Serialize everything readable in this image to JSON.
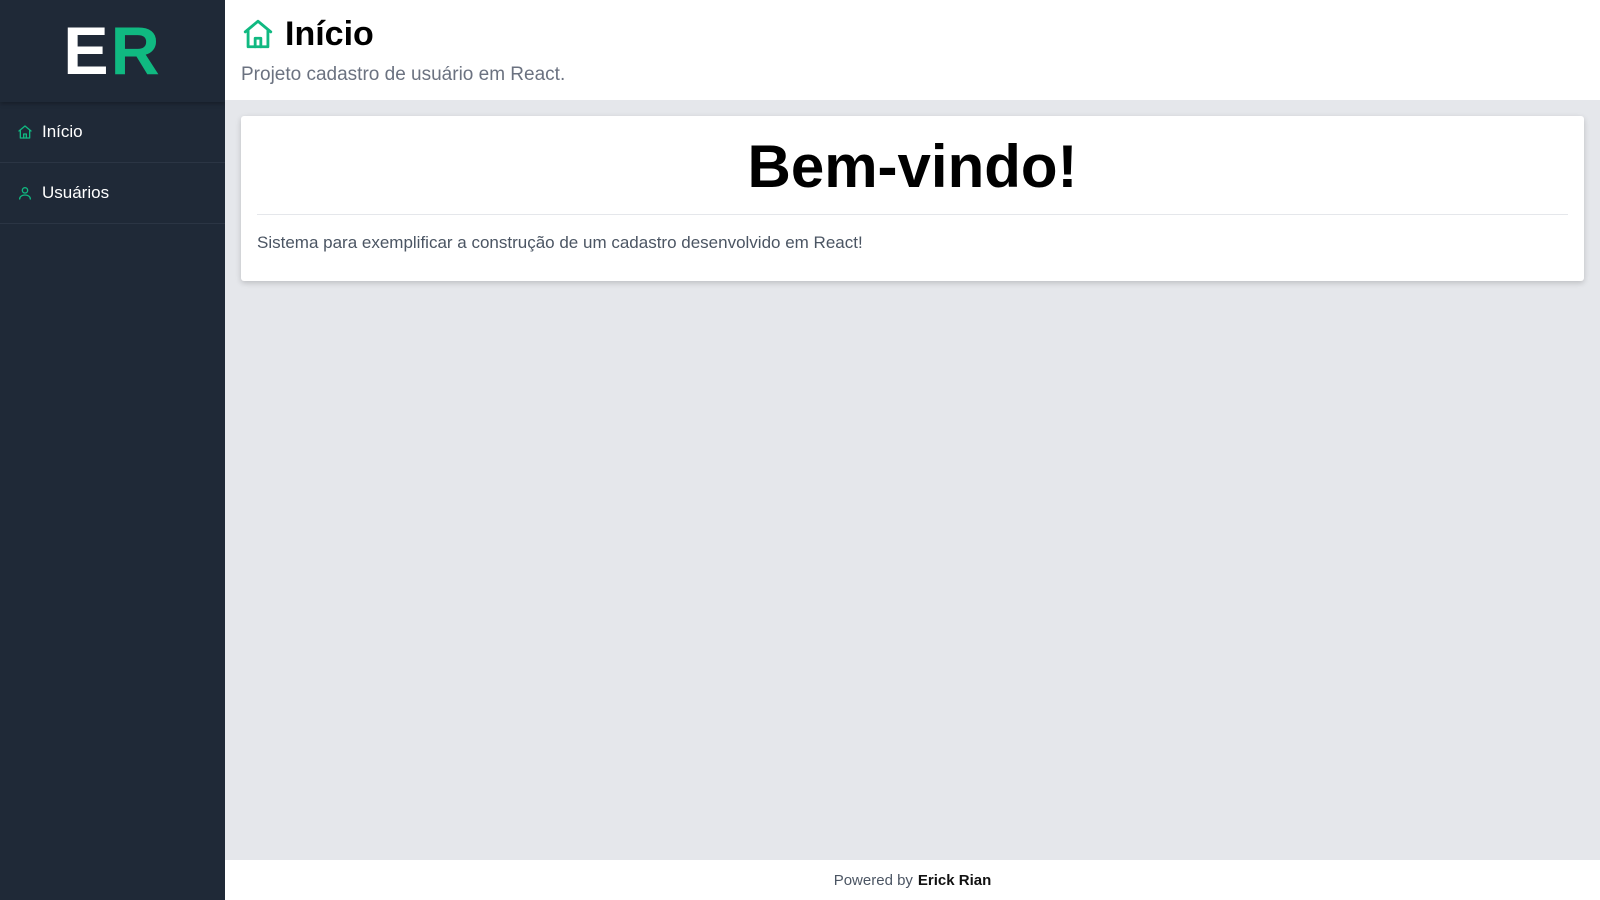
{
  "logo": {
    "letter_1": "E",
    "letter_2": "R",
    "accent_color": "#10b981"
  },
  "sidebar": {
    "items": [
      {
        "label": "Início",
        "icon": "home-icon"
      },
      {
        "label": "Usuários",
        "icon": "user-icon"
      }
    ]
  },
  "header": {
    "icon": "home-icon",
    "title": "Início",
    "subtitle": "Projeto cadastro de usuário em React."
  },
  "main": {
    "heading": "Bem-vindo!",
    "description": "Sistema para exemplificar a construção de um cadastro desenvolvido em React!"
  },
  "footer": {
    "prefix": "Powered by",
    "author": "Erick Rian"
  },
  "colors": {
    "sidebar_bg": "#1f2937",
    "content_bg": "#e5e7eb",
    "accent": "#10b981"
  }
}
